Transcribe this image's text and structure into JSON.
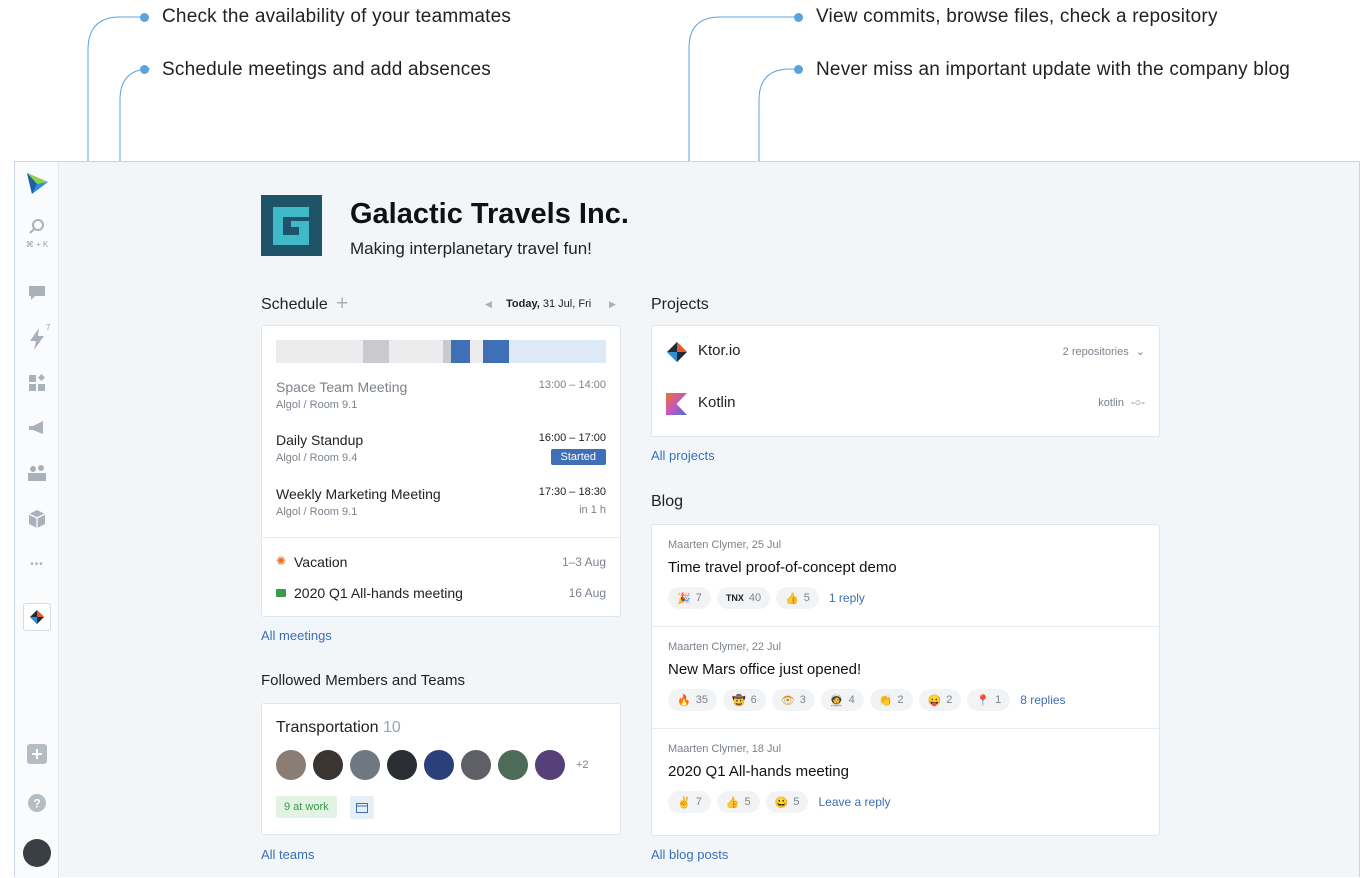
{
  "callouts": {
    "availability": "Check the availability of your teammates",
    "schedule": "Schedule meetings and add absences",
    "commits": "View commits, browse files, check a repository",
    "blog": "Never miss an important update with the company blog"
  },
  "sidebar": {
    "search_shortcut": "⌘ + K",
    "lightning_badge": "7",
    "more": "•••",
    "icons": [
      "space-logo-icon",
      "search-icon",
      "chat-icon",
      "lightning-icon",
      "apps-icon",
      "megaphone-icon",
      "team-icon",
      "package-icon",
      "more-icon",
      "project-ktor-icon",
      "add-icon",
      "help-icon",
      "avatar"
    ]
  },
  "org": {
    "name": "Galactic Travels Inc.",
    "tagline": "Making interplanetary travel fun!"
  },
  "schedule": {
    "title": "Schedule",
    "add": "+",
    "date_bold": "Today,",
    "date_rest": " 31 Jul, Fri",
    "meetings": [
      {
        "title": "Space Team Meeting",
        "room": "Algol / Room 9.1",
        "time": "13:00 – 14:00",
        "status": ""
      },
      {
        "title": "Daily Standup",
        "room": "Algol / Room 9.4",
        "time": "16:00 – 17:00",
        "status": "Started"
      },
      {
        "title": "Weekly Marketing Meeting",
        "room": "Algol / Room 9.1",
        "time": "17:30 – 18:30",
        "status": "in 1 h"
      }
    ],
    "events": [
      {
        "title": "Vacation",
        "date": "1–3 Aug"
      },
      {
        "title": "2020 Q1 All-hands meeting",
        "date": "16 Aug"
      }
    ],
    "all_link": "All meetings"
  },
  "followed": {
    "title": "Followed Members and Teams",
    "team_name": "Transportation",
    "team_count": "10",
    "more": "+2",
    "at_work": "9 at work",
    "all_link": "All teams"
  },
  "projects": {
    "title": "Projects",
    "items": [
      {
        "name": "Ktor.io",
        "meta": "2 repositories"
      },
      {
        "name": "Kotlin",
        "meta": "kotlin"
      }
    ],
    "all_link": "All projects"
  },
  "blog": {
    "title": "Blog",
    "posts": [
      {
        "author": "Maarten Clymer, 25 Jul",
        "title": "Time travel proof-of-concept demo",
        "reactions": [
          {
            "e": "🎉",
            "n": "7"
          },
          {
            "e": "TNX",
            "n": "40"
          },
          {
            "e": "👍",
            "n": "5"
          }
        ],
        "replies": "1 reply"
      },
      {
        "author": "Maarten Clymer, 22 Jul",
        "title": "New Mars office just opened!",
        "reactions": [
          {
            "e": "🔥",
            "n": "35"
          },
          {
            "e": "🤠",
            "n": "6"
          },
          {
            "e": "👁",
            "n": "3"
          },
          {
            "e": "🧑‍🚀",
            "n": "4"
          },
          {
            "e": "👏",
            "n": "2"
          },
          {
            "e": "😛",
            "n": "2"
          },
          {
            "e": "📍",
            "n": "1"
          }
        ],
        "replies": "8 replies"
      },
      {
        "author": "Maarten Clymer, 18 Jul",
        "title": "2020 Q1 All-hands meeting",
        "reactions": [
          {
            "e": "✌",
            "n": "7"
          },
          {
            "e": "👍",
            "n": "5"
          },
          {
            "e": "😀",
            "n": "5"
          }
        ],
        "replies": "Leave a reply"
      }
    ],
    "all_link": "All blog posts"
  },
  "colors": {
    "accent": "#3f6fb4",
    "callout_line": "#5aa3dd",
    "link": "#3b6fb5"
  }
}
